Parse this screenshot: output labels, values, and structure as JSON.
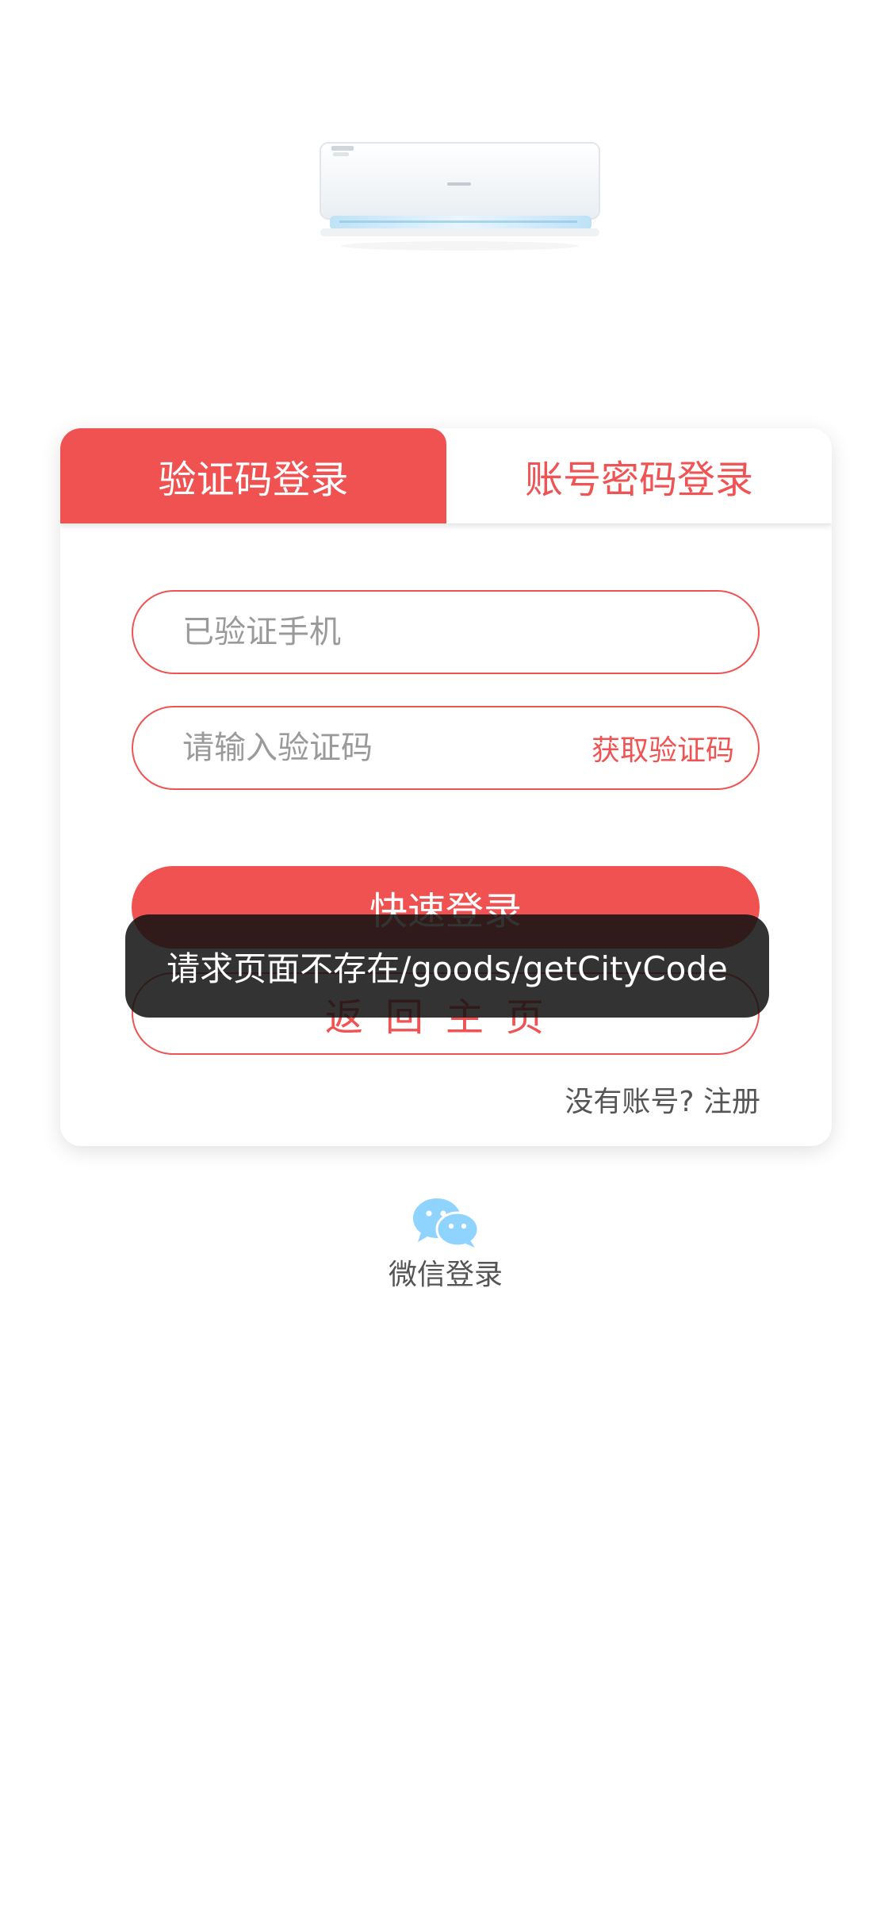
{
  "login": {
    "tabs": {
      "sms": "验证码登录",
      "password": "账号密码登录"
    },
    "phone_placeholder": "已验证手机",
    "code_placeholder": "请输入验证码",
    "get_code": "获取验证码",
    "quick_login": "快速登录",
    "back_home": "返回主页",
    "no_account": "没有账号?",
    "register": "注册"
  },
  "toast": {
    "message": "请求页面不存在/goods/getCityCode"
  },
  "wechat": {
    "label": "微信登录"
  },
  "colors": {
    "accent": "#f05252",
    "wechat": "#8fd3ff"
  },
  "icons": {
    "product": "air-conditioner-image",
    "wechat": "wechat-icon"
  }
}
